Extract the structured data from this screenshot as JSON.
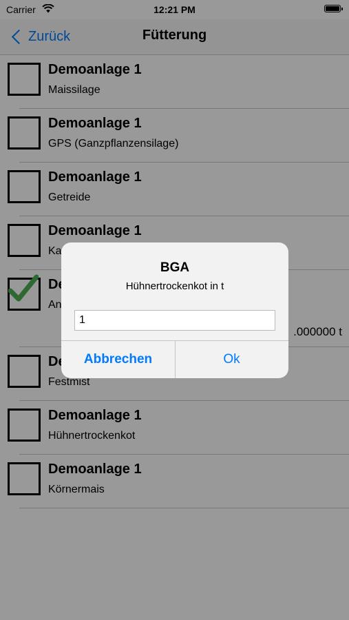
{
  "status_bar": {
    "carrier": "Carrier",
    "time": "12:21 PM"
  },
  "nav": {
    "back_label": "Zurück",
    "title": "Fütterung"
  },
  "list": {
    "items": [
      {
        "title": "Demoanlage 1",
        "subtitle": "Maissilage",
        "checked": false
      },
      {
        "title": "Demoanlage 1",
        "subtitle": "GPS (Ganzpflanzensilage)",
        "checked": false
      },
      {
        "title": "Demoanlage 1",
        "subtitle": "Getreide",
        "checked": false
      },
      {
        "title": "Demoanlage 1",
        "subtitle": "Ka",
        "checked": false
      },
      {
        "title": "De",
        "subtitle": "An",
        "checked": true,
        "amount": ".000000 t"
      },
      {
        "title": "De",
        "subtitle": "Festmist",
        "checked": false
      },
      {
        "title": "Demoanlage 1",
        "subtitle": "Hühnertrockenkot",
        "checked": false
      },
      {
        "title": "Demoanlage 1",
        "subtitle": "Körnermais",
        "checked": false
      }
    ]
  },
  "alert": {
    "title": "BGA",
    "message": "Hühnertrockenkot in t",
    "input_value": "1",
    "cancel_label": "Abbrechen",
    "ok_label": "Ok"
  },
  "colors": {
    "accent": "#007aff",
    "check": "#4caf50",
    "overlay": "rgba(0,0,0,0.40)"
  }
}
